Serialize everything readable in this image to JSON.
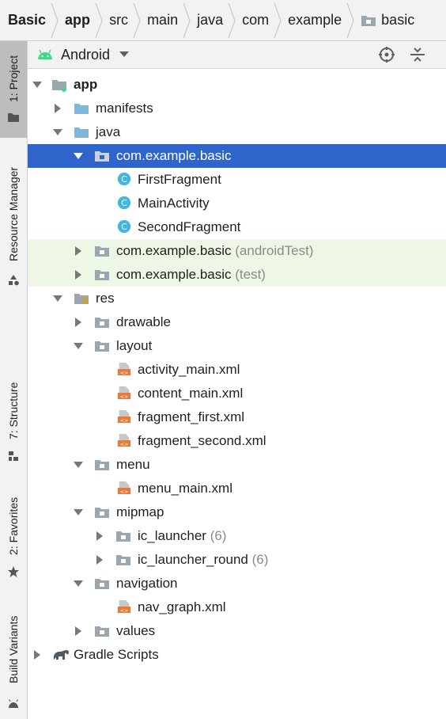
{
  "breadcrumb": [
    "Basic",
    "app",
    "src",
    "main",
    "java",
    "com",
    "example",
    "basic"
  ],
  "sidebar": {
    "project": "1: Project",
    "resource_manager": "Resource Manager",
    "structure": "7: Structure",
    "favorites": "2: Favorites",
    "build_variants": "Build Variants"
  },
  "header": {
    "view_mode": "Android"
  },
  "tree": [
    {
      "label": "app",
      "suffix": ""
    },
    {
      "label": "manifests",
      "suffix": ""
    },
    {
      "label": "java",
      "suffix": ""
    },
    {
      "label": "com.example.basic",
      "suffix": ""
    },
    {
      "label": "FirstFragment",
      "suffix": ""
    },
    {
      "label": "MainActivity",
      "suffix": ""
    },
    {
      "label": "SecondFragment",
      "suffix": ""
    },
    {
      "label": "com.example.basic",
      "suffix": "(androidTest)"
    },
    {
      "label": "com.example.basic",
      "suffix": "(test)"
    },
    {
      "label": "res",
      "suffix": ""
    },
    {
      "label": "drawable",
      "suffix": ""
    },
    {
      "label": "layout",
      "suffix": ""
    },
    {
      "label": "activity_main.xml",
      "suffix": ""
    },
    {
      "label": "content_main.xml",
      "suffix": ""
    },
    {
      "label": "fragment_first.xml",
      "suffix": ""
    },
    {
      "label": "fragment_second.xml",
      "suffix": ""
    },
    {
      "label": "menu",
      "suffix": ""
    },
    {
      "label": "menu_main.xml",
      "suffix": ""
    },
    {
      "label": "mipmap",
      "suffix": ""
    },
    {
      "label": "ic_launcher",
      "suffix": "(6)"
    },
    {
      "label": "ic_launcher_round",
      "suffix": "(6)"
    },
    {
      "label": "navigation",
      "suffix": ""
    },
    {
      "label": "nav_graph.xml",
      "suffix": ""
    },
    {
      "label": "values",
      "suffix": ""
    },
    {
      "label": "Gradle Scripts",
      "suffix": ""
    }
  ],
  "colors": {
    "selection": "#2f65ca",
    "test_highlight": "#eef7e6",
    "folder": "#7fb6dc",
    "package": "#9aa7b0",
    "class_icon": "#40b6e0",
    "xml_icon": "#e57a3c",
    "android_green": "#3ddc84"
  }
}
